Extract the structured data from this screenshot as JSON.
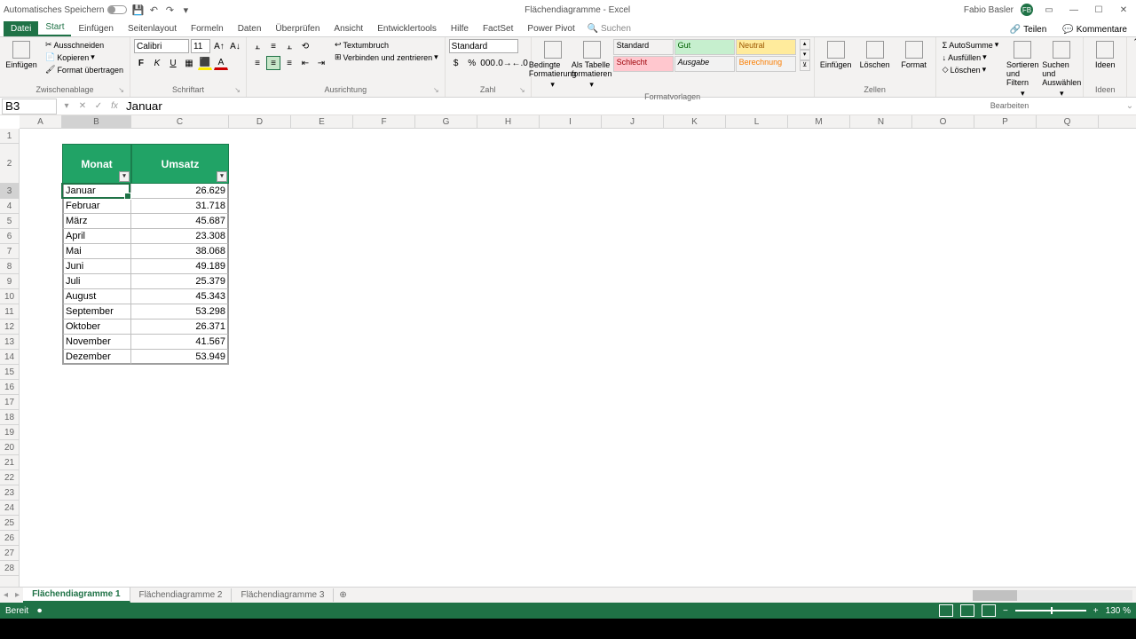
{
  "title": {
    "doc": "Flächendiagramme",
    "app": "Excel",
    "autosave": "Automatisches Speichern",
    "user": "Fabio Basler",
    "badge": "FB"
  },
  "tabs": {
    "file": "Datei",
    "items": [
      "Start",
      "Einfügen",
      "Seitenlayout",
      "Formeln",
      "Daten",
      "Überprüfen",
      "Ansicht",
      "Entwicklertools",
      "Hilfe",
      "FactSet",
      "Power Pivot"
    ],
    "search": "Suchen",
    "share": "Teilen",
    "comments": "Kommentare"
  },
  "ribbon": {
    "clipboard": {
      "paste": "Einfügen",
      "cut": "Ausschneiden",
      "copy": "Kopieren",
      "format_painter": "Format übertragen",
      "label": "Zwischenablage"
    },
    "font": {
      "name": "Calibri",
      "size": "11",
      "label": "Schriftart"
    },
    "alignment": {
      "wrap": "Textumbruch",
      "merge": "Verbinden und zentrieren",
      "label": "Ausrichtung"
    },
    "number": {
      "format": "Standard",
      "label": "Zahl"
    },
    "styles": {
      "cond": "Bedingte Formatierung",
      "table": "Als Tabelle formatieren",
      "r1": [
        "Standard",
        "Gut",
        "Neutral"
      ],
      "r2": [
        "Schlecht",
        "Ausgabe",
        "Berechnung"
      ],
      "label": "Formatvorlagen"
    },
    "cells": {
      "insert": "Einfügen",
      "delete": "Löschen",
      "format": "Format",
      "label": "Zellen"
    },
    "editing": {
      "sum": "AutoSumme",
      "fill": "Ausfüllen",
      "clear": "Löschen",
      "sort": "Sortieren und Filtern",
      "find": "Suchen und Auswählen",
      "label": "Bearbeiten"
    },
    "ideas": {
      "btn": "Ideen",
      "label": "Ideen"
    }
  },
  "namebox": "B3",
  "formula": "Januar",
  "columns": [
    "A",
    "B",
    "C",
    "D",
    "E",
    "F",
    "G",
    "H",
    "I",
    "J",
    "K",
    "L",
    "M",
    "N",
    "O",
    "P",
    "Q"
  ],
  "table": {
    "headers": [
      "Monat",
      "Umsatz"
    ],
    "rows": [
      [
        "Januar",
        "26.629"
      ],
      [
        "Februar",
        "31.718"
      ],
      [
        "März",
        "45.687"
      ],
      [
        "April",
        "23.308"
      ],
      [
        "Mai",
        "38.068"
      ],
      [
        "Juni",
        "49.189"
      ],
      [
        "Juli",
        "25.379"
      ],
      [
        "August",
        "45.343"
      ],
      [
        "September",
        "53.298"
      ],
      [
        "Oktober",
        "26.371"
      ],
      [
        "November",
        "41.567"
      ],
      [
        "Dezember",
        "53.949"
      ]
    ]
  },
  "chart_data": {
    "type": "table",
    "categories": [
      "Januar",
      "Februar",
      "März",
      "April",
      "Mai",
      "Juni",
      "Juli",
      "August",
      "September",
      "Oktober",
      "November",
      "Dezember"
    ],
    "values": [
      26629,
      31718,
      45687,
      23308,
      38068,
      49189,
      25379,
      45343,
      53298,
      26371,
      41567,
      53949
    ],
    "series_name": "Umsatz",
    "xlabel": "Monat"
  },
  "sheets": [
    "Flächendiagramme 1",
    "Flächendiagramme 2",
    "Flächendiagramme 3"
  ],
  "status": {
    "ready": "Bereit",
    "zoom": "130 %"
  }
}
